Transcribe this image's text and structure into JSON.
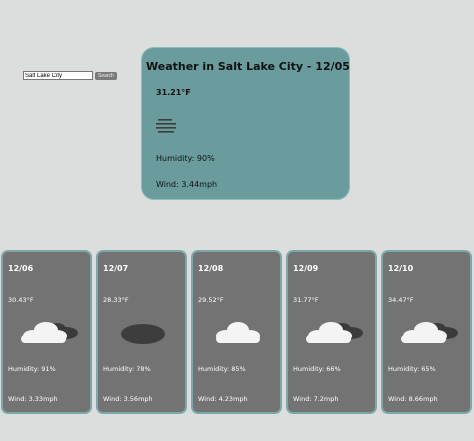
{
  "search": {
    "value": "Salt Lake City",
    "button_label": "Search"
  },
  "current": {
    "title": "Weather in Salt Lake City - 12/05",
    "temp": "31.21°F",
    "icon": "mist-icon",
    "humidity": "Humidity: 90%",
    "wind": "Wind: 3.44mph"
  },
  "forecast": [
    {
      "date": "12/06",
      "temp": "30.43°F",
      "icon": "broken-clouds-icon",
      "humidity": "Humidity: 91%",
      "wind": "Wind: 3.33mph"
    },
    {
      "date": "12/07",
      "temp": "28.33°F",
      "icon": "overcast-clouds-icon",
      "humidity": "Humidity: 78%",
      "wind": "Wind: 3.56mph"
    },
    {
      "date": "12/08",
      "temp": "29.52°F",
      "icon": "few-clouds-icon",
      "humidity": "Humidity: 85%",
      "wind": "Wind: 4.23mph"
    },
    {
      "date": "12/09",
      "temp": "31.77°F",
      "icon": "broken-clouds-icon",
      "humidity": "Humidity: 66%",
      "wind": "Wind: 7.2mph"
    },
    {
      "date": "12/10",
      "temp": "34.47°F",
      "icon": "broken-clouds-icon",
      "humidity": "Humidity: 65%",
      "wind": "Wind: 8.66mph"
    }
  ],
  "colors": {
    "background": "#dcdedd",
    "current_card": "#6a9c9d",
    "forecast_card": "#737373",
    "card_border": "#7ba9a9"
  }
}
